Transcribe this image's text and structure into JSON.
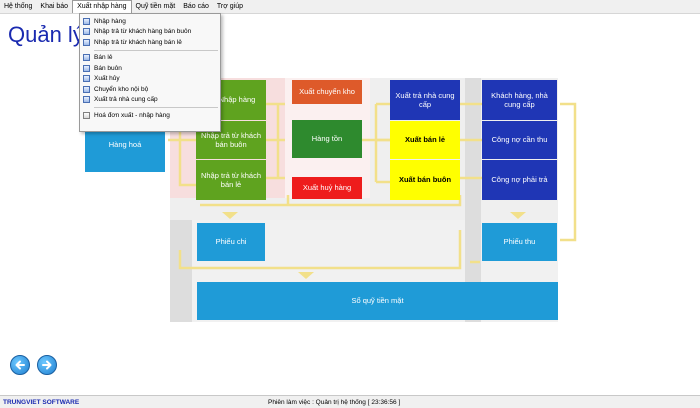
{
  "menubar": {
    "items": [
      "Hệ thống",
      "Khai báo",
      "Xuất nhập hàng",
      "Quỹ tiền mặt",
      "Báo cáo",
      "Trợ giúp"
    ]
  },
  "app_title": "Quản lý",
  "dropdown": {
    "group1": [
      "Nhập hàng",
      "Nhập trả từ khách hàng bán buôn",
      "Nhập trả từ khách hàng bán lẻ"
    ],
    "group2": [
      "Bán lẻ",
      "Bán buôn",
      "Xuất hủy",
      "Chuyển kho nội bộ",
      "Xuất trả nhà cung cấp"
    ],
    "group3": [
      "Hoá đơn xuất - nhập hàng"
    ]
  },
  "diagram": {
    "hang_hoa": "Hàng hoá",
    "nhap_hang": "Nhập hàng",
    "nhap_tra_buon": "Nhập trả từ khách bán buôn",
    "nhap_tra_le": "Nhập trả từ khách bán lẻ",
    "xuat_chuyen_kho": "Xuất chuyển kho",
    "hang_ton": "Hàng tồn",
    "xuat_huy": "Xuất huỷ hàng",
    "xuat_tra_ncc": "Xuất trả nhà cung cấp",
    "xuat_ban_le": "Xuất bán lẻ",
    "xuat_ban_buon": "Xuất bán buôn",
    "khach_hang_ncc": "Khách hàng, nhà cung cấp",
    "cong_no_can_thu": "Công nợ cần thu",
    "cong_no_phai_tra": "Công nợ phải trả",
    "phieu_chi": "Phiếu chi",
    "phieu_thu": "Phiếu thu",
    "so_quy": "Sổ quỹ tiền mặt"
  },
  "colors": {
    "blue": "#1f9bd7",
    "green": "#5fa31f",
    "navy": "#1f36b5",
    "yellow": "#ffff00",
    "red": "#ee1c1c",
    "orange": "#de5a2a",
    "connector": "#f2e08a"
  },
  "status": {
    "brand": "TRUNGVIET SOFTWARE",
    "session": "Phiên làm việc :  Quản trị hệ thống  [ 23:36:56 ]"
  }
}
